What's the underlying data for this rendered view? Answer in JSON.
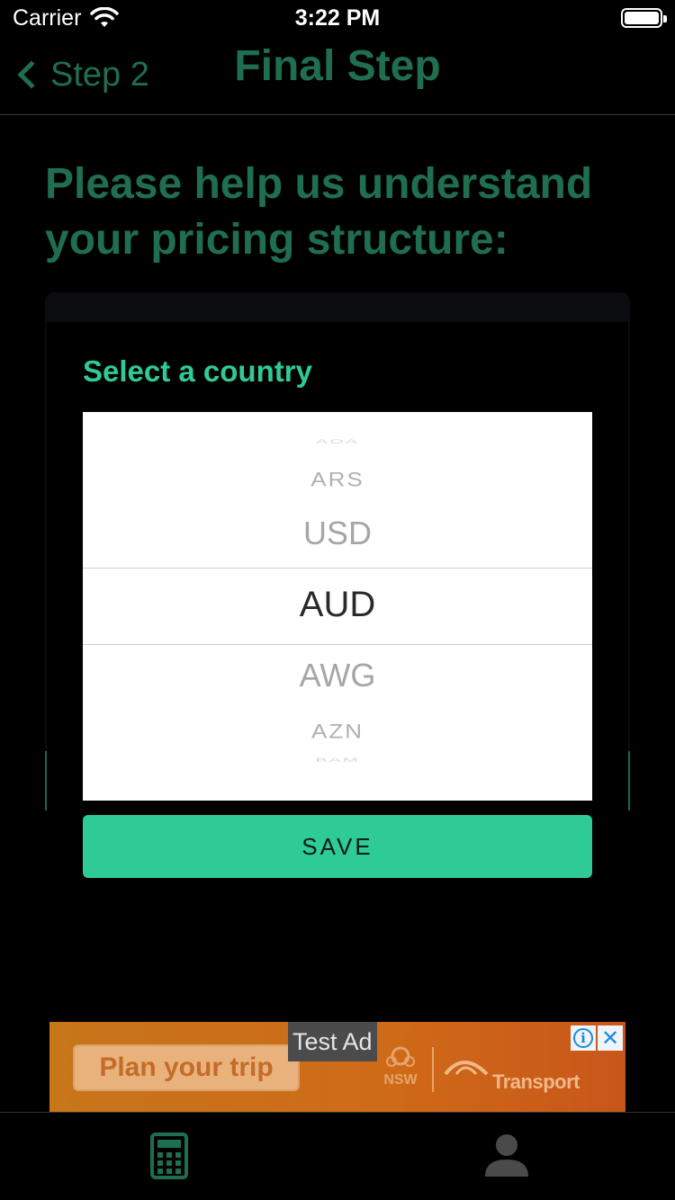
{
  "status_bar": {
    "carrier": "Carrier",
    "time": "3:22 PM",
    "wifi_icon": "wifi-icon",
    "battery_icon": "battery-icon"
  },
  "nav": {
    "back_label": "Step 2",
    "title": "Final Step"
  },
  "question": "Please help us understand your pricing structure:",
  "modal": {
    "title": "Select a country",
    "picker": {
      "items": [
        "AOA",
        "ARS",
        "USD",
        "AUD",
        "AWG",
        "AZN",
        "BAM"
      ],
      "selected": "AUD"
    },
    "save_label": "SAVE"
  },
  "ad": {
    "cta": "Plan your trip",
    "badge": "Test Ad",
    "logo_text": "NSW",
    "brand": "Transport",
    "info_icon": "info-icon",
    "close_icon": "close-icon"
  },
  "tab_bar": {
    "items": [
      {
        "icon": "calculator-icon"
      },
      {
        "icon": "profile-icon"
      }
    ]
  },
  "colors": {
    "accent_dark": "#1f6e4f",
    "accent": "#2fcb96",
    "background": "#000000",
    "ad_orange": "#cf6a18"
  }
}
